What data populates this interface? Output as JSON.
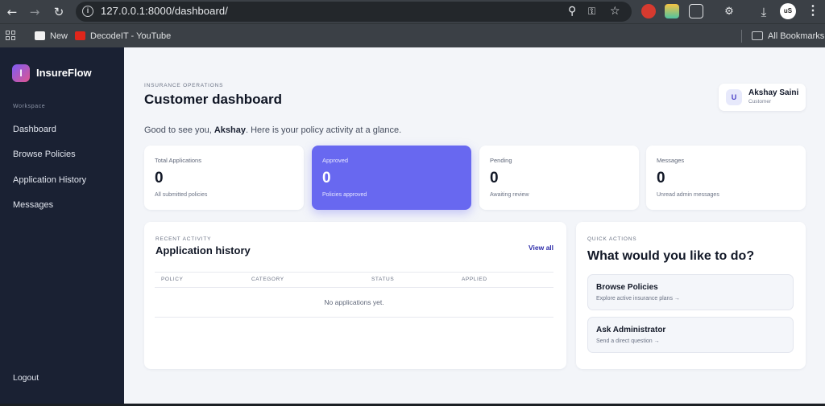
{
  "browser": {
    "url": "127.0.0.1:8000/dashboard/",
    "bookmarks": [
      {
        "label": "New"
      },
      {
        "label": "DecodeIT - YouTube"
      }
    ],
    "all_bookmarks_label": "All Bookmarks",
    "profile_badge": "uS"
  },
  "app": {
    "name": "InsureFlow",
    "logo_letter": "I"
  },
  "sidebar": {
    "section_label": "Workspace",
    "items": [
      {
        "label": "Dashboard"
      },
      {
        "label": "Browse Policies"
      },
      {
        "label": "Application History"
      },
      {
        "label": "Messages"
      }
    ],
    "logout_label": "Logout"
  },
  "header": {
    "eyebrow": "INSURANCE OPERATIONS",
    "title": "Customer dashboard",
    "greeting_prefix": "Good to see you, ",
    "greeting_name": "Akshay",
    "greeting_suffix": ". Here is your policy activity at a glance."
  },
  "user": {
    "initial": "U",
    "name": "Akshay Saini",
    "role": "Customer"
  },
  "stats": [
    {
      "label": "Total Applications",
      "value": "0",
      "sub": "All submitted policies"
    },
    {
      "label": "Approved",
      "value": "0",
      "sub": "Policies approved"
    },
    {
      "label": "Pending",
      "value": "0",
      "sub": "Awaiting review"
    },
    {
      "label": "Messages",
      "value": "0",
      "sub": "Unread admin messages"
    }
  ],
  "activity": {
    "eyebrow": "RECENT ACTIVITY",
    "title": "Application history",
    "view_all": "View all",
    "columns": [
      "POLICY",
      "CATEGORY",
      "STATUS",
      "APPLIED"
    ],
    "empty_text": "No applications yet."
  },
  "quick_actions": {
    "eyebrow": "QUICK ACTIONS",
    "title": "What would you like to do?",
    "items": [
      {
        "title": "Browse Policies",
        "subtitle": "Explore active insurance plans →"
      },
      {
        "title": "Ask Administrator",
        "subtitle": "Send a direct question →"
      }
    ]
  },
  "colors": {
    "accent": "#6868f0",
    "sidebar_bg": "#1a2133",
    "page_bg": "#f3f5f9"
  }
}
